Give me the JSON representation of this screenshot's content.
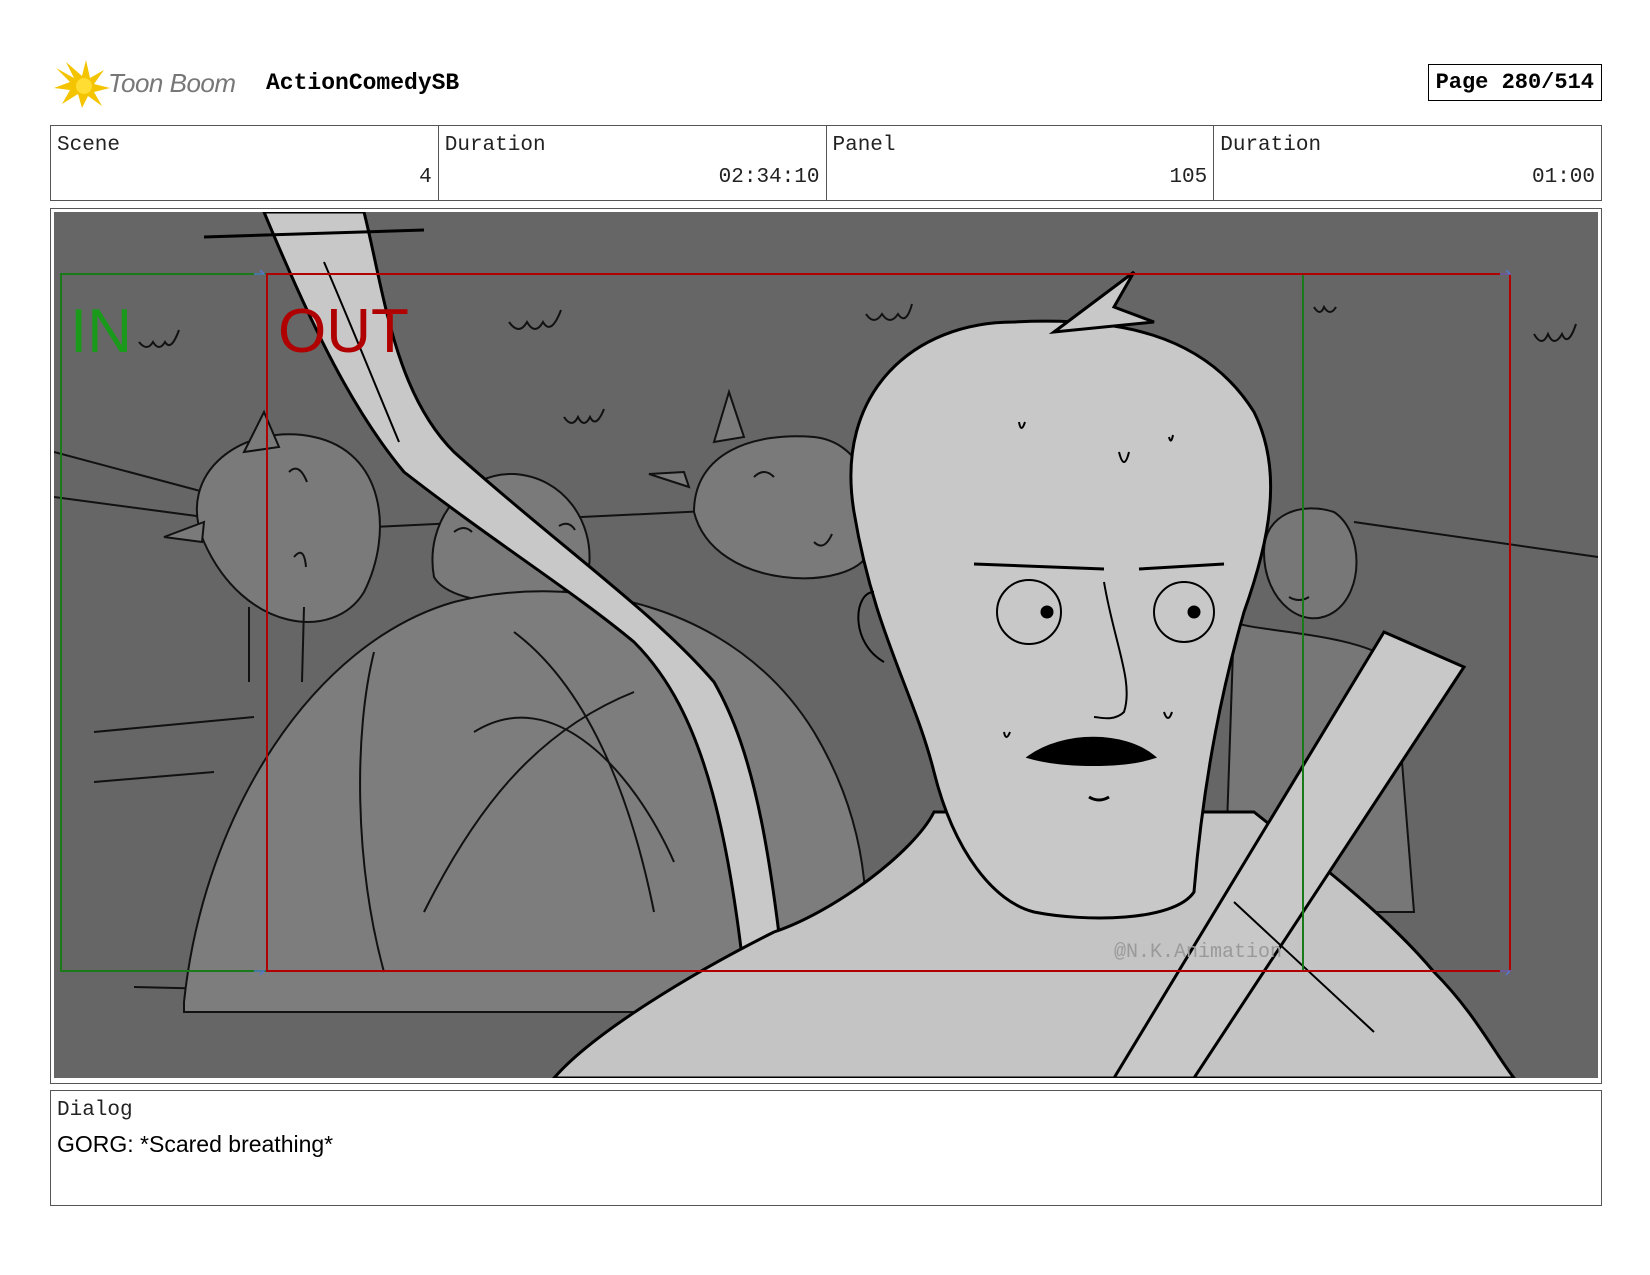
{
  "header": {
    "logo_text": "Toon Boom",
    "project_title": "ActionComedySB",
    "page_label": "Page 280/514"
  },
  "info": {
    "scene_label": "Scene",
    "scene_value": "4",
    "scene_duration_label": "Duration",
    "scene_duration_value": "02:34:10",
    "panel_label": "Panel",
    "panel_value": "105",
    "panel_duration_label": "Duration",
    "panel_duration_value": "01:00"
  },
  "frame": {
    "in_label": "IN",
    "out_label": "OUT",
    "watermark": "@N.K.Animation",
    "in_color": "#1a9a1a",
    "out_color": "#b00000"
  },
  "dialog": {
    "label": "Dialog",
    "text": "GORG: *Scared breathing*"
  }
}
